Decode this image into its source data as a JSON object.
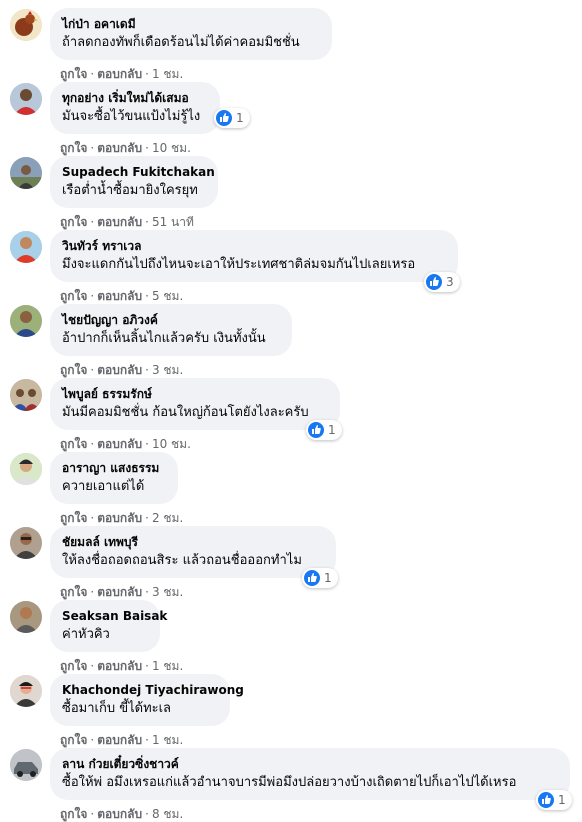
{
  "actions": {
    "like": "ถูกใจ",
    "reply": "ตอบกลับ",
    "separator": "·"
  },
  "colors": {
    "bubble": "#f0f2f5",
    "meta_text": "#65676b",
    "like_blue": "#1877f2"
  },
  "comments": [
    {
      "author": "ไก่ป่า อคาเดมี",
      "text": "ถ้าลดกองทัพก็เดือดร้อนไม่ได้ค่าคอมมิชชั่น",
      "time": "1 ชม.",
      "reactions": null,
      "avatar_icon": "rooster-avatar-icon"
    },
    {
      "author": "ทุกอย่าง เริ่มใหม่ได้เสมอ",
      "text": "มันจะซื้อไว้ขนแป้งไม่รู้ไง",
      "time": "10 ชม.",
      "reactions": "1",
      "avatar_icon": "person-avatar-icon"
    },
    {
      "author": "Supadech Fukitchakan",
      "text": "เรือต่ำน้ำซื้อมายิงใครยุท",
      "time": "51 นาที",
      "reactions": null,
      "avatar_icon": "person-avatar-icon"
    },
    {
      "author": "วินทัวร์ ทราเวล",
      "text": "มึงจะแดกกันไปถึงไหนจะเอาให้ประเทศชาติล่มจมกันไปเลยเหรอ",
      "time": "5 ชม.",
      "reactions": "3",
      "avatar_icon": "person-avatar-icon"
    },
    {
      "author": "ไชยปัญญา อภิวงค์",
      "text": "อ้าปากก็เห็นลิ้นไกแล้วครับ เงินทั้งนั้น",
      "time": "3 ชม.",
      "reactions": null,
      "avatar_icon": "person-avatar-icon"
    },
    {
      "author": "ไพบูลย์ ธรรมรักษ์",
      "text": "มันมีคอมมิชชั่น ก้อนใหญ่ก้อนโตยังไงละครับ",
      "time": "10 ชม.",
      "reactions": "1",
      "avatar_icon": "group-avatar-icon"
    },
    {
      "author": "อาราญา แสงธรรม",
      "text": "ควายเอาแต่ได้",
      "time": "2 ชม.",
      "reactions": null,
      "avatar_icon": "person-avatar-icon"
    },
    {
      "author": "ชัยมลล์ เทพบุรี",
      "text": "ให้ลงชื่อถอดถอนสิระ แล้วถอนชื่อออกทำไม",
      "time": "3 ชม.",
      "reactions": "1",
      "avatar_icon": "person-avatar-icon"
    },
    {
      "author": "Seaksan Baisak",
      "text": "ค่าหัวคิว",
      "time": "1 ชม.",
      "reactions": null,
      "avatar_icon": "person-avatar-icon"
    },
    {
      "author": "Khachondej Tiyachirawong",
      "text": "ซื้อมาเก็บ ขี้ได้ทะเล",
      "time": "1 ชม.",
      "reactions": null,
      "avatar_icon": "person-avatar-icon"
    },
    {
      "author": "ลาน ก๋วยเตี๋ยวซิ่งชาวค์",
      "text": "ซื้อให้พ่ อมึงเหรอแก่แล้วอำนาจบารมีพ่อมึงปล่อยวางบ้างเถิดตายไปก็เอาไปได้เหรอ",
      "time": "8 ชม.",
      "reactions": "1",
      "avatar_icon": "car-avatar-icon"
    }
  ]
}
